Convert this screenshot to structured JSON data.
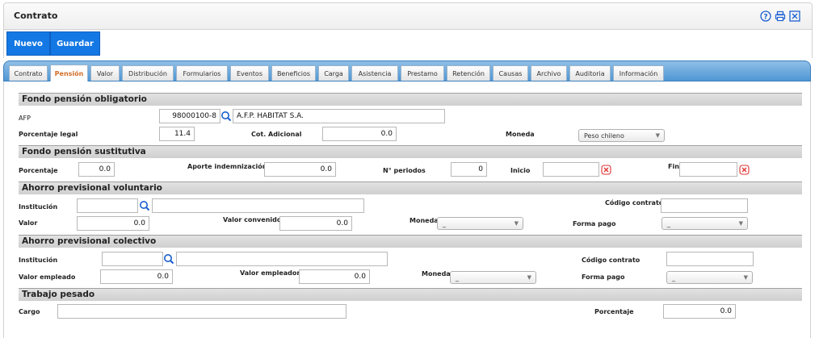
{
  "window": {
    "title": "Contrato"
  },
  "toolbar": {
    "new_label": "Nuevo",
    "save_label": "Guardar"
  },
  "tabs": [
    "Contrato",
    "Pensión",
    "Valor",
    "Distribución",
    "Formularios",
    "Eventos",
    "Beneficios",
    "Carga",
    "Asistencia",
    "Prestamo",
    "Retención",
    "Causas",
    "Archivo",
    "Auditoria",
    "Información"
  ],
  "active_tab": "Pensión",
  "mandatory": {
    "section_title": "Fondo pensión obligatorio",
    "afp_label": "AFP",
    "afp_code": "98000100-8",
    "afp_name": "A.F.P. HABITAT S.A.",
    "pct_label": "Porcentaje legal",
    "pct_value": "11.4",
    "cot_label": "Cot. Adicional",
    "cot_value": "0.0",
    "currency_label": "Moneda",
    "currency_value": "Peso chileno"
  },
  "substitute": {
    "section_title": "Fondo pensión sustitutiva",
    "pct_label": "Porcentaje",
    "pct_value": "0.0",
    "aporte_label": "Aporte indemnización",
    "aporte_value": "0.0",
    "periods_label": "N° periodos",
    "periods_value": "0",
    "start_label": "Inicio",
    "start_value": "",
    "end_label": "Fin",
    "end_value": ""
  },
  "voluntary": {
    "section_title": "Ahorro previsional voluntario",
    "inst_label": "Institución",
    "inst_code": "",
    "inst_name": "",
    "contract_label": "Código contrato",
    "contract_value": "",
    "value_label": "Valor",
    "value_value": "0.0",
    "agreed_label": "Valor convenido",
    "agreed_value": "0.0",
    "currency_label": "Moneda",
    "currency_value": "_",
    "payment_label": "Forma pago",
    "payment_value": "_"
  },
  "collective": {
    "section_title": "Ahorro previsional colectivo",
    "inst_label": "Institución",
    "inst_code": "",
    "inst_name": "",
    "contract_label": "Código contrato",
    "contract_value": "",
    "employee_label": "Valor empleado",
    "employee_value": "0.0",
    "employer_label": "Valor empleador",
    "employer_value": "0.0",
    "currency_label": "Moneda",
    "currency_value": "_",
    "payment_label": "Forma pago",
    "payment_value": "_"
  },
  "heavy_work": {
    "section_title": "Trabajo pesado",
    "position_label": "Cargo",
    "position_value": "",
    "pct_label": "Porcentaje",
    "pct_value": "0.0"
  },
  "colors": {
    "primary_button": "#1478e4",
    "tab_bar": "#4f97d4",
    "active_tab_text": "#d0702a",
    "clear_icon": "#e03030",
    "search_icon": "#1a5fd0"
  },
  "icons": [
    "help-icon",
    "print-icon",
    "close-icon",
    "search-icon",
    "clear-icon",
    "chevron-down-icon"
  ]
}
